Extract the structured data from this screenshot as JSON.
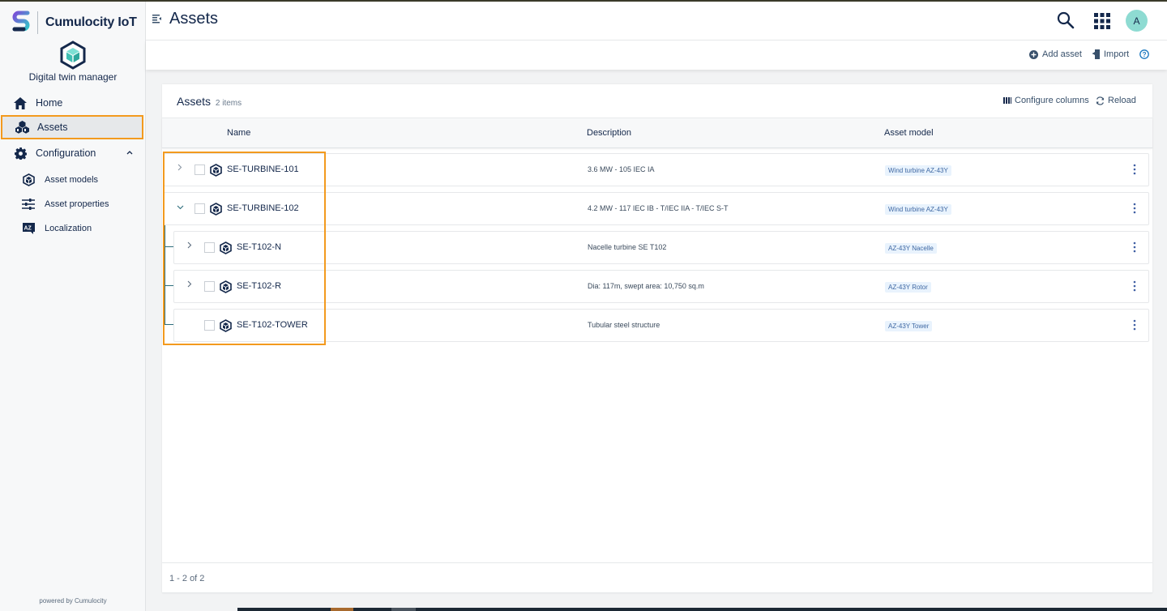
{
  "brand": {
    "name": "Cumulocity IoT"
  },
  "app": {
    "name": "Digital twin manager"
  },
  "sidebar": {
    "items": [
      {
        "label": "Home",
        "icon": "home-icon"
      },
      {
        "label": "Assets",
        "icon": "assets-icon",
        "active": true
      },
      {
        "label": "Configuration",
        "icon": "gear-icon",
        "expanded": true
      }
    ],
    "sub_items": [
      {
        "label": "Asset models",
        "icon": "cube-icon"
      },
      {
        "label": "Asset properties",
        "icon": "sliders-icon"
      },
      {
        "label": "Localization",
        "icon": "localization-icon"
      }
    ],
    "powered_by": "powered by Cumulocity"
  },
  "header": {
    "title": "Assets",
    "avatar_initial": "A",
    "avatar_color": "#8edbd2"
  },
  "actions": {
    "add_asset": "Add asset",
    "import": "Import"
  },
  "card": {
    "title": "Assets",
    "count": "2 items",
    "configure_columns": "Configure columns",
    "reload": "Reload",
    "columns": {
      "name": "Name",
      "description": "Description",
      "asset_model": "Asset model"
    },
    "rows": [
      {
        "name": "SE-TURBINE-101",
        "description": "3.6 MW - 105 IEC IA",
        "model": "Wind turbine AZ-43Y",
        "expander": "collapsed",
        "level": 0
      },
      {
        "name": "SE-TURBINE-102",
        "description": "4.2 MW - 117 IEC IB - T/IEC IIA - T/IEC S-T",
        "model": "Wind turbine AZ-43Y",
        "expander": "expanded",
        "level": 0
      },
      {
        "name": "SE-T102-N",
        "description": "Nacelle turbine SE T102",
        "model": "AZ-43Y Nacelle",
        "expander": "collapsed",
        "level": 1
      },
      {
        "name": "SE-T102-R",
        "description": "Dia: 117m, swept area: 10,750 sq.m",
        "model": "AZ-43Y Rotor",
        "expander": "collapsed",
        "level": 1
      },
      {
        "name": "SE-T102-TOWER",
        "description": "Tubular steel structure",
        "model": "AZ-43Y Tower",
        "expander": "none",
        "level": 1
      }
    ],
    "pagination": "1 - 2 of 2"
  },
  "colors": {
    "accent_orange": "#f39a1e",
    "primary_text": "#14284b",
    "badge_bg": "#e9f3fd",
    "badge_text": "#3f68a3",
    "tree_line": "#2d6d7b"
  }
}
